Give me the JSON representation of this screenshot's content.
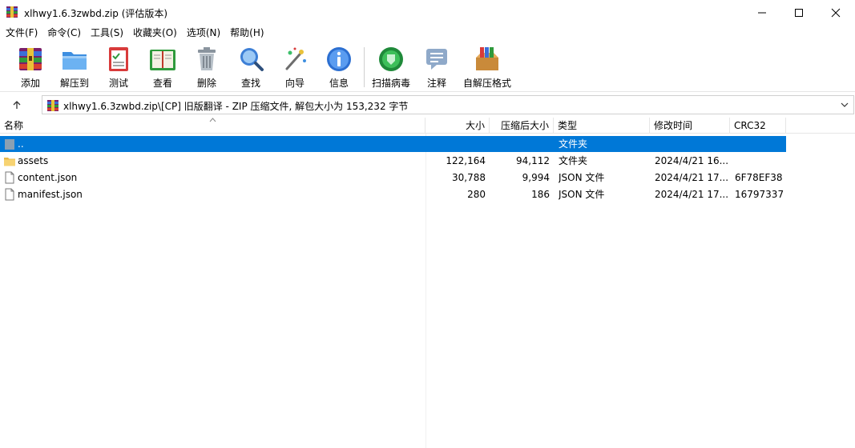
{
  "window": {
    "title": "xlhwy1.6.3zwbd.zip (评估版本)"
  },
  "menu": [
    "文件(F)",
    "命令(C)",
    "工具(S)",
    "收藏夹(O)",
    "选项(N)",
    "帮助(H)"
  ],
  "toolbar": {
    "items": [
      {
        "label": "添加",
        "icon": "add-archive-icon"
      },
      {
        "label": "解压到",
        "icon": "extract-folder-icon"
      },
      {
        "label": "测试",
        "icon": "test-checklist-icon"
      },
      {
        "label": "查看",
        "icon": "view-book-icon"
      },
      {
        "label": "删除",
        "icon": "trash-icon"
      },
      {
        "label": "查找",
        "icon": "magnifier-icon"
      },
      {
        "label": "向导",
        "icon": "wizard-wand-icon"
      },
      {
        "label": "信息",
        "icon": "info-icon"
      },
      {
        "label": "扫描病毒",
        "icon": "virus-scan-icon"
      },
      {
        "label": "注释",
        "icon": "comment-icon"
      },
      {
        "label": "自解压格式",
        "icon": "sfx-box-icon"
      }
    ]
  },
  "address": {
    "path": "xlhwy1.6.3zwbd.zip\\[CP] 旧版翻译 - ZIP 压缩文件, 解包大小为 153,232 字节"
  },
  "columns": [
    "名称",
    "大小",
    "压缩后大小",
    "类型",
    "修改时间",
    "CRC32"
  ],
  "rows": [
    {
      "name": "..",
      "size": "",
      "packed": "",
      "type": "文件夹",
      "modified": "",
      "crc": "",
      "kind": "parent",
      "selected": true
    },
    {
      "name": "assets",
      "size": "122,164",
      "packed": "94,112",
      "type": "文件夹",
      "modified": "2024/4/21 16...",
      "crc": "",
      "kind": "folder",
      "selected": false
    },
    {
      "name": "content.json",
      "size": "30,788",
      "packed": "9,994",
      "type": "JSON 文件",
      "modified": "2024/4/21 17...",
      "crc": "6F78EF38",
      "kind": "file",
      "selected": false
    },
    {
      "name": "manifest.json",
      "size": "280",
      "packed": "186",
      "type": "JSON 文件",
      "modified": "2024/4/21 17...",
      "crc": "16797337",
      "kind": "file",
      "selected": false
    }
  ],
  "colors": {
    "selection": "#0078d7"
  }
}
